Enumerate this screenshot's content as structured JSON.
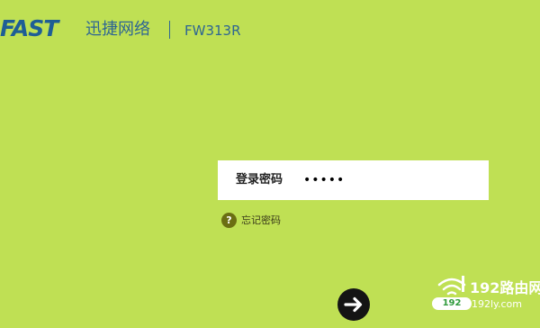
{
  "header": {
    "logo_text": "FAST",
    "brand_name": "迅捷网络",
    "model": "FW313R"
  },
  "login": {
    "label": "登录密码",
    "password_value": "•••••",
    "forgot_text": "忘记密码",
    "help_icon_glyph": "?"
  },
  "watermark": {
    "title": "192路由网",
    "url": "192ly.com",
    "badge": "192"
  },
  "icons": {
    "submit": "arrow-right-icon",
    "help": "question-icon",
    "signal": "wifi-signal-icon"
  },
  "colors": {
    "background": "#bfe054",
    "brand": "#1f5e95",
    "login_button": "#141414",
    "help_icon": "#6b6e12"
  }
}
